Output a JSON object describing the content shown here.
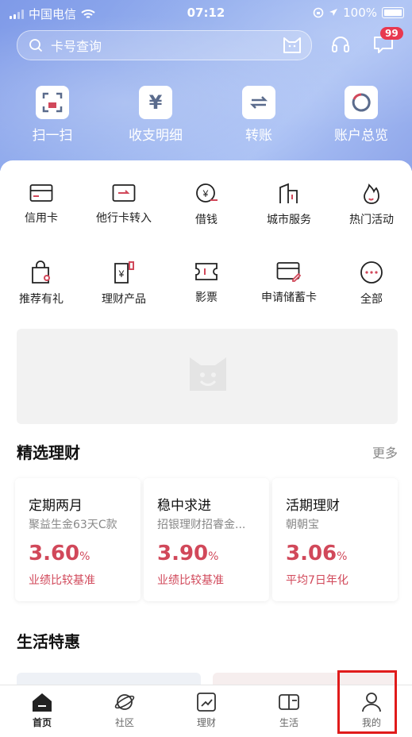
{
  "status": {
    "carrier": "中国电信",
    "time": "07:12",
    "battery": "100%"
  },
  "search": {
    "placeholder": "卡号查询"
  },
  "header": {
    "message_badge": "99"
  },
  "quick_actions": [
    {
      "label": "扫一扫",
      "icon": "scan-icon"
    },
    {
      "label": "收支明细",
      "icon": "yuan-icon"
    },
    {
      "label": "转账",
      "icon": "transfer-icon"
    },
    {
      "label": "账户总览",
      "icon": "account-overview-icon"
    }
  ],
  "services": [
    {
      "label": "信用卡",
      "icon": "credit-card-icon"
    },
    {
      "label": "他行卡转入",
      "icon": "card-transfer-in-icon"
    },
    {
      "label": "借钱",
      "icon": "borrow-icon"
    },
    {
      "label": "城市服务",
      "icon": "city-icon"
    },
    {
      "label": "热门活动",
      "icon": "flame-icon"
    },
    {
      "label": "推荐有礼",
      "icon": "gift-bag-icon"
    },
    {
      "label": "理财产品",
      "icon": "wealth-product-icon"
    },
    {
      "label": "影票",
      "icon": "ticket-icon"
    },
    {
      "label": "申请储蓄卡",
      "icon": "apply-card-icon"
    },
    {
      "label": "全部",
      "icon": "more-dots-icon"
    }
  ],
  "wealth": {
    "title": "精选理财",
    "more": "更多",
    "cards": [
      {
        "title": "定期两月",
        "subtitle": "聚益生金63天C款",
        "rate": "3.60",
        "unit": "%",
        "note": "业绩比较基准"
      },
      {
        "title": "稳中求进",
        "subtitle": "招银理财招睿金...",
        "rate": "3.90",
        "unit": "%",
        "note": "业绩比较基准"
      },
      {
        "title": "活期理财",
        "subtitle": "朝朝宝",
        "rate": "3.06",
        "unit": "%",
        "note": "平均7日年化"
      }
    ]
  },
  "life": {
    "title": "生活特惠"
  },
  "tabs": [
    {
      "label": "首页",
      "icon": "home-icon"
    },
    {
      "label": "社区",
      "icon": "planet-icon"
    },
    {
      "label": "理财",
      "icon": "chart-icon"
    },
    {
      "label": "生活",
      "icon": "wallet-icon"
    },
    {
      "label": "我的",
      "icon": "user-icon"
    }
  ],
  "colors": {
    "accent_red": "#d1485a",
    "hero_blue": "#8fa6ea",
    "highlight_box": "#e01b1b"
  }
}
